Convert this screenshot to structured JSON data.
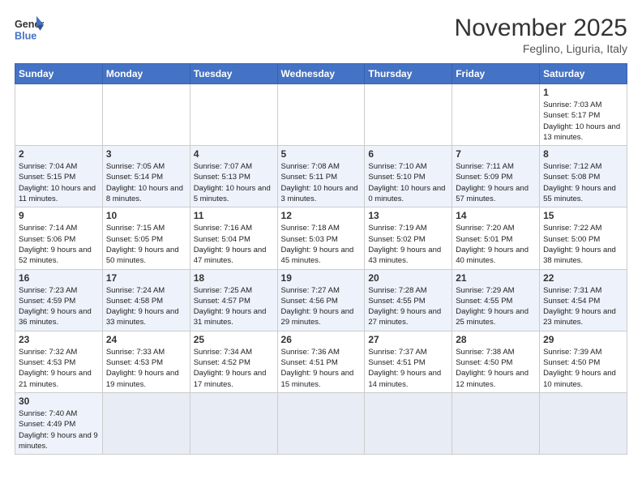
{
  "logo": {
    "text_general": "General",
    "text_blue": "Blue"
  },
  "title": "November 2025",
  "subtitle": "Feglino, Liguria, Italy",
  "days_of_week": [
    "Sunday",
    "Monday",
    "Tuesday",
    "Wednesday",
    "Thursday",
    "Friday",
    "Saturday"
  ],
  "weeks": [
    [
      {
        "day": "",
        "info": ""
      },
      {
        "day": "",
        "info": ""
      },
      {
        "day": "",
        "info": ""
      },
      {
        "day": "",
        "info": ""
      },
      {
        "day": "",
        "info": ""
      },
      {
        "day": "",
        "info": ""
      },
      {
        "day": "1",
        "info": "Sunrise: 7:03 AM\nSunset: 5:17 PM\nDaylight: 10 hours and 13 minutes."
      }
    ],
    [
      {
        "day": "2",
        "info": "Sunrise: 7:04 AM\nSunset: 5:15 PM\nDaylight: 10 hours and 11 minutes."
      },
      {
        "day": "3",
        "info": "Sunrise: 7:05 AM\nSunset: 5:14 PM\nDaylight: 10 hours and 8 minutes."
      },
      {
        "day": "4",
        "info": "Sunrise: 7:07 AM\nSunset: 5:13 PM\nDaylight: 10 hours and 5 minutes."
      },
      {
        "day": "5",
        "info": "Sunrise: 7:08 AM\nSunset: 5:11 PM\nDaylight: 10 hours and 3 minutes."
      },
      {
        "day": "6",
        "info": "Sunrise: 7:10 AM\nSunset: 5:10 PM\nDaylight: 10 hours and 0 minutes."
      },
      {
        "day": "7",
        "info": "Sunrise: 7:11 AM\nSunset: 5:09 PM\nDaylight: 9 hours and 57 minutes."
      },
      {
        "day": "8",
        "info": "Sunrise: 7:12 AM\nSunset: 5:08 PM\nDaylight: 9 hours and 55 minutes."
      }
    ],
    [
      {
        "day": "9",
        "info": "Sunrise: 7:14 AM\nSunset: 5:06 PM\nDaylight: 9 hours and 52 minutes."
      },
      {
        "day": "10",
        "info": "Sunrise: 7:15 AM\nSunset: 5:05 PM\nDaylight: 9 hours and 50 minutes."
      },
      {
        "day": "11",
        "info": "Sunrise: 7:16 AM\nSunset: 5:04 PM\nDaylight: 9 hours and 47 minutes."
      },
      {
        "day": "12",
        "info": "Sunrise: 7:18 AM\nSunset: 5:03 PM\nDaylight: 9 hours and 45 minutes."
      },
      {
        "day": "13",
        "info": "Sunrise: 7:19 AM\nSunset: 5:02 PM\nDaylight: 9 hours and 43 minutes."
      },
      {
        "day": "14",
        "info": "Sunrise: 7:20 AM\nSunset: 5:01 PM\nDaylight: 9 hours and 40 minutes."
      },
      {
        "day": "15",
        "info": "Sunrise: 7:22 AM\nSunset: 5:00 PM\nDaylight: 9 hours and 38 minutes."
      }
    ],
    [
      {
        "day": "16",
        "info": "Sunrise: 7:23 AM\nSunset: 4:59 PM\nDaylight: 9 hours and 36 minutes."
      },
      {
        "day": "17",
        "info": "Sunrise: 7:24 AM\nSunset: 4:58 PM\nDaylight: 9 hours and 33 minutes."
      },
      {
        "day": "18",
        "info": "Sunrise: 7:25 AM\nSunset: 4:57 PM\nDaylight: 9 hours and 31 minutes."
      },
      {
        "day": "19",
        "info": "Sunrise: 7:27 AM\nSunset: 4:56 PM\nDaylight: 9 hours and 29 minutes."
      },
      {
        "day": "20",
        "info": "Sunrise: 7:28 AM\nSunset: 4:55 PM\nDaylight: 9 hours and 27 minutes."
      },
      {
        "day": "21",
        "info": "Sunrise: 7:29 AM\nSunset: 4:55 PM\nDaylight: 9 hours and 25 minutes."
      },
      {
        "day": "22",
        "info": "Sunrise: 7:31 AM\nSunset: 4:54 PM\nDaylight: 9 hours and 23 minutes."
      }
    ],
    [
      {
        "day": "23",
        "info": "Sunrise: 7:32 AM\nSunset: 4:53 PM\nDaylight: 9 hours and 21 minutes."
      },
      {
        "day": "24",
        "info": "Sunrise: 7:33 AM\nSunset: 4:53 PM\nDaylight: 9 hours and 19 minutes."
      },
      {
        "day": "25",
        "info": "Sunrise: 7:34 AM\nSunset: 4:52 PM\nDaylight: 9 hours and 17 minutes."
      },
      {
        "day": "26",
        "info": "Sunrise: 7:36 AM\nSunset: 4:51 PM\nDaylight: 9 hours and 15 minutes."
      },
      {
        "day": "27",
        "info": "Sunrise: 7:37 AM\nSunset: 4:51 PM\nDaylight: 9 hours and 14 minutes."
      },
      {
        "day": "28",
        "info": "Sunrise: 7:38 AM\nSunset: 4:50 PM\nDaylight: 9 hours and 12 minutes."
      },
      {
        "day": "29",
        "info": "Sunrise: 7:39 AM\nSunset: 4:50 PM\nDaylight: 9 hours and 10 minutes."
      }
    ],
    [
      {
        "day": "30",
        "info": "Sunrise: 7:40 AM\nSunset: 4:49 PM\nDaylight: 9 hours and 9 minutes."
      },
      {
        "day": "",
        "info": ""
      },
      {
        "day": "",
        "info": ""
      },
      {
        "day": "",
        "info": ""
      },
      {
        "day": "",
        "info": ""
      },
      {
        "day": "",
        "info": ""
      },
      {
        "day": "",
        "info": ""
      }
    ]
  ]
}
